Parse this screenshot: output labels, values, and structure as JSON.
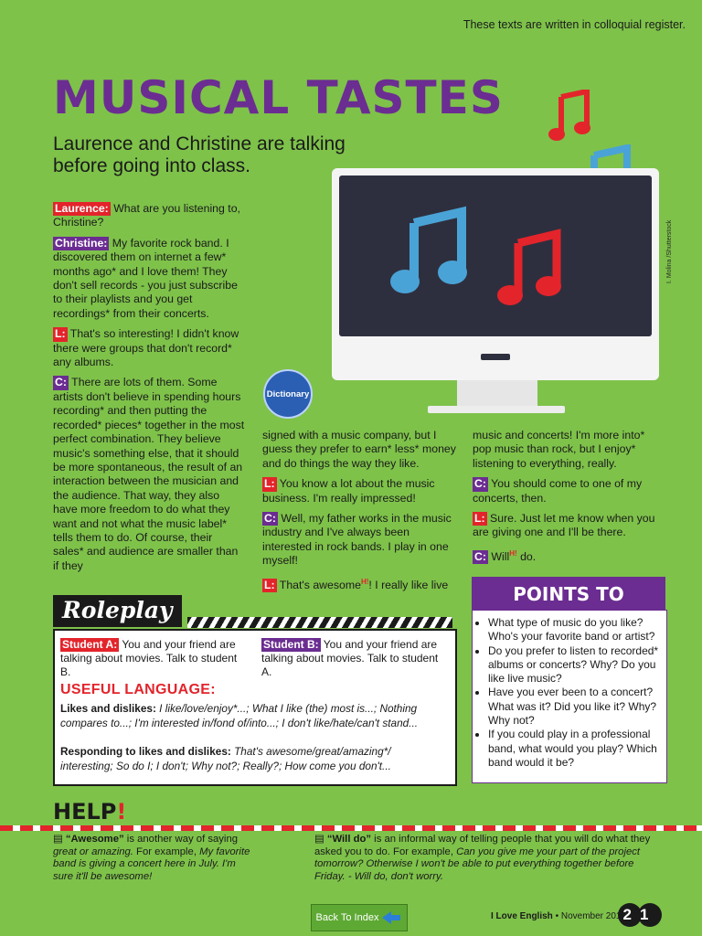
{
  "top_note": "These texts are written in colloquial register.",
  "title": "MUSICAL TASTES",
  "subtitle": "Laurence and Christine are talking before going into class.",
  "credit": "I. Molina /Shutterstock",
  "dictionary_badge": "Dictionary",
  "dialogue": {
    "l1_tag": "Laurence:",
    "l1_text": " What are you listening to, Christine?",
    "c1_tag": "Christine:",
    "c1_text": " My favorite rock band. I discovered them on internet a few* months ago* and I love them! They don't sell records - you just subscribe to their playlists and you get recordings* from their concerts.",
    "l2_tag": "L:",
    "l2_text": " That's so interesting! I didn't know there were groups that don't record* any albums.",
    "c2_tag": "C:",
    "c2_text": " There are lots of them. Some artists don't believe in spending hours recording* and then putting the recorded* pieces* together in the most perfect combination. They believe music's something else, that it should be more spontaneous, the result of an interaction between the musician and the audience. That way, they also have more freedom to do what they want and not what the music label* tells them to do. Of course, their sales* and audience are smaller than if they",
    "c2_cont": "signed with a music company, but I guess they prefer to earn* less* money and do things the way they like.",
    "l3_tag": "L:",
    "l3_text": " You know a lot about the music business. I'm really impressed!",
    "c3_tag": "C:",
    "c3_text": " Well, my father works in the music industry and I've always been interested in rock bands. I play in one myself!",
    "l4_tag": "L:",
    "l4_text_a": " That's awesome",
    "l4_sup": "H!",
    "l4_text_b": "! I really like live",
    "l4_cont": "music and concerts! I'm more into* pop music than rock, but I enjoy* listening to everything, really.",
    "c4_tag": "C:",
    "c4_text": " You should come to one of my concerts, then.",
    "l5_tag": "L:",
    "l5_text": " Sure. Just let me know when you are giving one and I'll be there.",
    "c5_tag": "C:",
    "c5_text_a": " Will",
    "c5_sup": "H!",
    "c5_text_b": " do."
  },
  "roleplay": {
    "header": "Roleplay",
    "student_a_tag": "Student A:",
    "student_a_text": " You and your friend are talking about movies. Talk to student B.",
    "student_b_tag": "Student B:",
    "student_b_text": " You and your friend are talking about movies. Talk to student A.",
    "useful_title": "USEFUL LANGUAGE:",
    "likes_label": "Likes and dislikes:",
    "likes_text": " I like/love/enjoy*...; What I like (the) most is...; Nothing compares to...; I'm interested in/fond of/into...; I don't like/hate/can't stand...",
    "responding_label": "Responding to likes and dislikes:",
    "responding_text": " That's awesome/great/amazing*/ interesting; So do I; I don't; Why not?; Really?; How come you don't..."
  },
  "discuss": {
    "header": "POINTS TO DISCUSS",
    "items": [
      "What type of music do you like? Who's your favorite band or artist?",
      "Do you prefer to listen to recorded* albums or concerts? Why? Do you like live music?",
      "Have you ever been to a concert? What was it? Did you like it? Why? Why not?",
      "If you could play in a professional band, what would you play? Which band would it be?"
    ]
  },
  "help": {
    "title": "HELP",
    "bang": "!",
    "note1_term": "“Awesome”",
    "note1_text": " is another way of saying ",
    "note1_ital": "great or amazing.",
    "note1_rest": " For example, ",
    "note1_example": "My favorite band is giving a concert here in July. I'm sure it'll be awesome!",
    "note2_term": "“Will do”",
    "note2_text": " is an informal way of telling people that you will do what they asked you to do. For example, ",
    "note2_example": "Can you give me your part of the project tomorrow? Otherwise I won't be able to put everything together before Friday. - Will do, don't worry."
  },
  "back_button": "Back To Index",
  "footer": {
    "brand": "I Love English",
    "date": " • November 2019",
    "page": "21"
  },
  "colors": {
    "background": "#7ec24a",
    "purple": "#6b2d91",
    "red": "#e3242b",
    "blue": "#4aa3d6"
  }
}
